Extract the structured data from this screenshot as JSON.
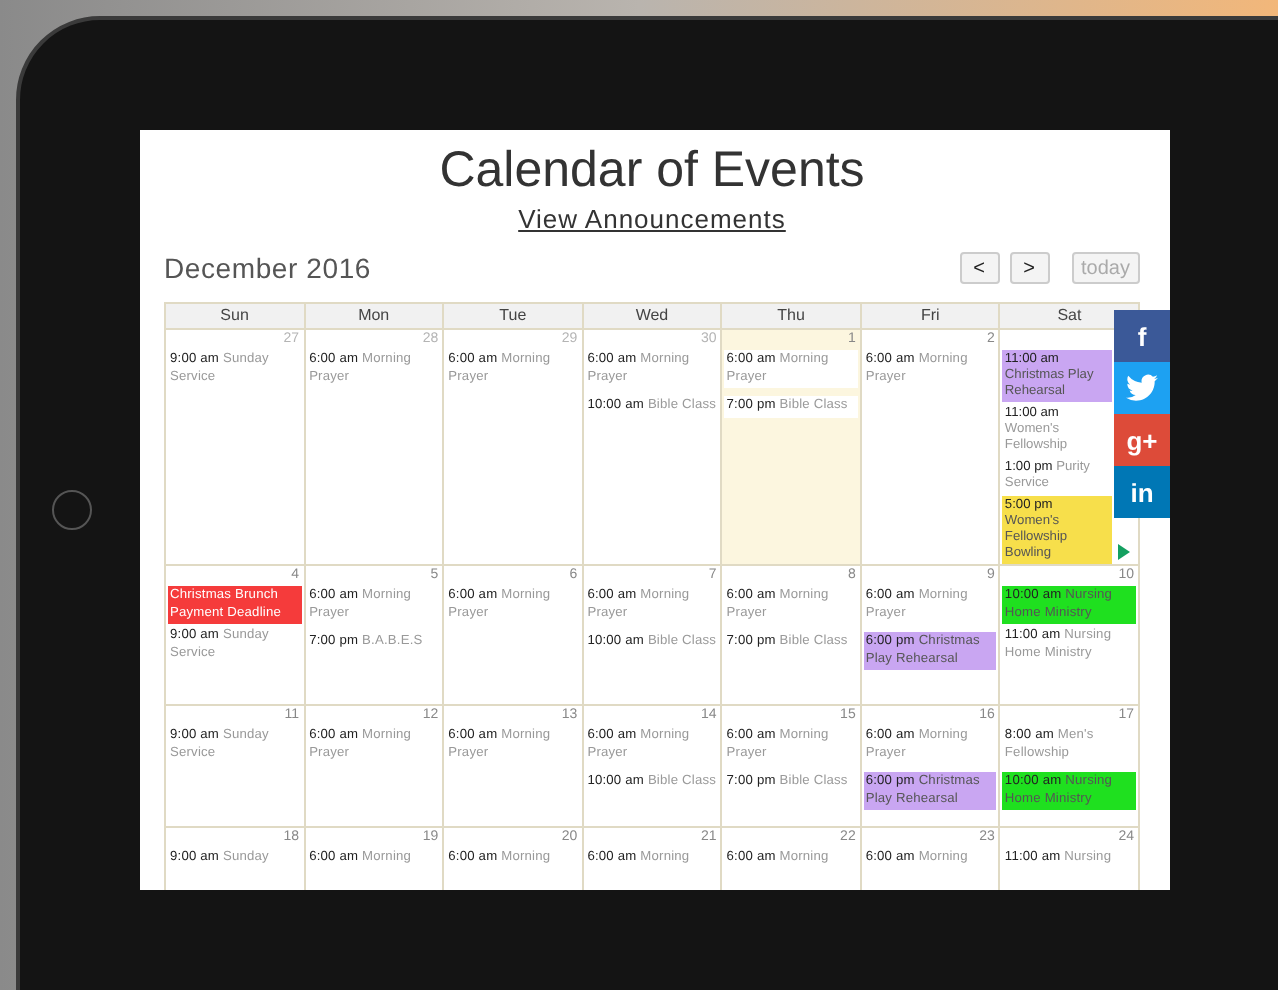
{
  "title": "Calendar of Events",
  "link": "View Announcements",
  "month": "December 2016",
  "nav_buttons": [
    {
      "label": "<",
      "disabled": false
    },
    {
      "label": ">",
      "disabled": false
    },
    {
      "label": "today",
      "disabled": true
    }
  ],
  "weekdays": [
    "Sun",
    "Mon",
    "Tue",
    "Wed",
    "Thu",
    "Fri",
    "Sat"
  ],
  "weeks": [
    {
      "days": [
        {
          "date": "27",
          "other_month": true,
          "today": false,
          "events": [
            {
              "time": "9:00 am",
              "title": "Sunday Service"
            }
          ]
        },
        {
          "date": "28",
          "other_month": true,
          "today": false,
          "events": [
            {
              "time": "6:00 am",
              "title": "Morning Prayer"
            }
          ]
        },
        {
          "date": "29",
          "other_month": true,
          "today": false,
          "events": [
            {
              "time": "6:00 am",
              "title": "Morning Prayer"
            }
          ]
        },
        {
          "date": "30",
          "other_month": true,
          "today": false,
          "events": [
            {
              "time": "6:00 am",
              "title": "Morning Prayer"
            },
            {
              "time": "10:00 am",
              "title": "Bible Class"
            }
          ]
        },
        {
          "date": "1",
          "other_month": false,
          "today": true,
          "events": [
            {
              "time": "6:00 am",
              "title": "Morning Prayer"
            },
            {
              "time": "7:00 pm",
              "title": "Bible Class"
            }
          ]
        },
        {
          "date": "2",
          "other_month": false,
          "today": false,
          "events": [
            {
              "time": "6:00 am",
              "title": "Morning Prayer"
            }
          ]
        },
        {
          "today": false,
          "events": [
            {
              "time": "11:00 am",
              "title": "Christmas Play Rehearsal",
              "color": "#c9a6f2"
            },
            {
              "time": "11:00 am",
              "title": "Women's Fellowship"
            },
            {
              "time": "1:00 pm",
              "title": "Purity Service"
            },
            {
              "time": "5:00 pm",
              "title": "Women's Fellowship Bowling",
              "color": "#f7df4b"
            }
          ]
        }
      ]
    },
    {
      "days": [
        {
          "date": "4",
          "other_month": false,
          "today": false,
          "events": [
            {
              "title": "Christmas Brunch Payment Deadline",
              "color": "#f53b3b"
            },
            {
              "time": "9:00 am",
              "title": "Sunday Service"
            }
          ]
        },
        {
          "date": "5",
          "other_month": false,
          "today": false,
          "events": [
            {
              "time": "6:00 am",
              "title": "Morning Prayer"
            },
            {
              "time": "7:00 pm",
              "title": "B.A.B.E.S"
            }
          ]
        },
        {
          "date": "6",
          "other_month": false,
          "today": false,
          "events": [
            {
              "time": "6:00 am",
              "title": "Morning Prayer"
            }
          ]
        },
        {
          "date": "7",
          "other_month": false,
          "today": false,
          "events": [
            {
              "time": "6:00 am",
              "title": "Morning Prayer"
            },
            {
              "time": "10:00 am",
              "title": "Bible Class"
            }
          ]
        },
        {
          "date": "8",
          "other_month": false,
          "today": false,
          "events": [
            {
              "time": "6:00 am",
              "title": "Morning Prayer"
            },
            {
              "time": "7:00 pm",
              "title": "Bible Class"
            }
          ]
        },
        {
          "date": "9",
          "other_month": false,
          "today": false,
          "events": [
            {
              "time": "6:00 am",
              "title": "Morning Prayer"
            },
            {
              "time": "6:00 pm",
              "title": "Christmas Play Rehearsal",
              "color": "#c9a6f2"
            }
          ]
        },
        {
          "date": "10",
          "other_month": false,
          "today": false,
          "events": [
            {
              "time": "10:00 am",
              "title": "Nursing Home Ministry",
              "color": "#1fe01f"
            },
            {
              "time": "11:00 am",
              "title": "Nursing Home Ministry"
            }
          ]
        }
      ]
    },
    {
      "days": [
        {
          "date": "11",
          "other_month": false,
          "today": false,
          "events": [
            {
              "time": "9:00 am",
              "title": "Sunday Service"
            }
          ]
        },
        {
          "date": "12",
          "other_month": false,
          "today": false,
          "events": [
            {
              "time": "6:00 am",
              "title": "Morning Prayer"
            }
          ]
        },
        {
          "date": "13",
          "other_month": false,
          "today": false,
          "events": [
            {
              "time": "6:00 am",
              "title": "Morning Prayer"
            }
          ]
        },
        {
          "date": "14",
          "other_month": false,
          "today": false,
          "events": [
            {
              "time": "6:00 am",
              "title": "Morning Prayer"
            },
            {
              "time": "10:00 am",
              "title": "Bible Class"
            }
          ]
        },
        {
          "date": "15",
          "other_month": false,
          "today": false,
          "events": [
            {
              "time": "6:00 am",
              "title": "Morning Prayer"
            },
            {
              "time": "7:00 pm",
              "title": "Bible Class"
            }
          ]
        },
        {
          "date": "16",
          "other_month": false,
          "today": false,
          "events": [
            {
              "time": "6:00 am",
              "title": "Morning Prayer"
            },
            {
              "time": "6:00 pm",
              "title": "Christmas Play Rehearsal",
              "color": "#c9a6f2"
            }
          ]
        },
        {
          "date": "17",
          "other_month": false,
          "today": false,
          "events": [
            {
              "time": "8:00 am",
              "title": "Men's Fellowship"
            },
            {
              "time": "10:00 am",
              "title": "Nursing Home Ministry",
              "color": "#1fe01f"
            }
          ]
        }
      ]
    },
    {
      "days": [
        {
          "date": "18",
          "other_month": false,
          "today": false,
          "events": [
            {
              "time": "9:00 am",
              "title": "Sunday"
            }
          ]
        },
        {
          "date": "19",
          "other_month": false,
          "today": false,
          "events": [
            {
              "time": "6:00 am",
              "title": "Morning"
            }
          ]
        },
        {
          "date": "20",
          "other_month": false,
          "today": false,
          "events": [
            {
              "time": "6:00 am",
              "title": "Morning"
            }
          ]
        },
        {
          "date": "21",
          "other_month": false,
          "today": false,
          "events": [
            {
              "time": "6:00 am",
              "title": "Morning"
            }
          ]
        },
        {
          "date": "22",
          "other_month": false,
          "today": false,
          "events": [
            {
              "time": "6:00 am",
              "title": "Morning"
            }
          ]
        },
        {
          "date": "23",
          "other_month": false,
          "today": false,
          "events": [
            {
              "time": "6:00 am",
              "title": "Morning"
            }
          ]
        },
        {
          "date": "24",
          "other_month": false,
          "today": false,
          "events": [
            {
              "time": "11:00 am",
              "title": "Nursing"
            }
          ]
        }
      ]
    }
  ],
  "share_buttons": [
    {
      "kind": "text",
      "label": "f",
      "color": "#3b5998"
    },
    {
      "kind": "bird",
      "color": "#1da1f2"
    },
    {
      "kind": "text",
      "label": "g+",
      "color": "#dd4b39"
    },
    {
      "kind": "text",
      "label": "in",
      "color": "#0077b5"
    }
  ]
}
